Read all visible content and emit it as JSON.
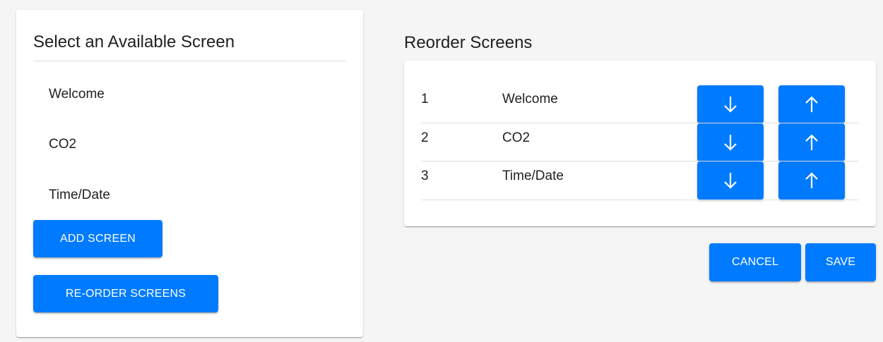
{
  "colors": {
    "accent": "#007bff",
    "page_background": "#f5f5f5",
    "card_background": "#ffffff",
    "text": "#212121",
    "button_text": "#ffffff"
  },
  "available_panel": {
    "title": "Select an Available Screen",
    "items": [
      {
        "label": "Welcome"
      },
      {
        "label": "CO2"
      },
      {
        "label": "Time/Date"
      }
    ],
    "add_button_label": "ADD SCREEN",
    "reorder_button_label": "RE-ORDER SCREENS"
  },
  "reorder_panel": {
    "title": "Reorder Screens",
    "rows": [
      {
        "number": "1",
        "name": "Welcome",
        "down_icon": "arrow-down-icon",
        "up_icon": "arrow-up-icon"
      },
      {
        "number": "2",
        "name": "CO2",
        "down_icon": "arrow-down-icon",
        "up_icon": "arrow-up-icon"
      },
      {
        "number": "3",
        "name": "Time/Date",
        "down_icon": "arrow-down-icon",
        "up_icon": "arrow-up-icon"
      }
    ],
    "cancel_label": "CANCEL",
    "save_label": "SAVE"
  }
}
